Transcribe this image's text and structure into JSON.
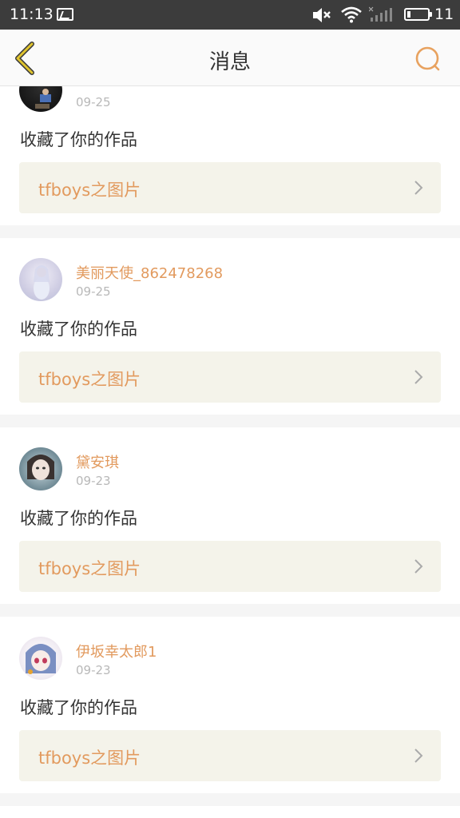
{
  "status_bar": {
    "time": "11:13",
    "battery": "11",
    "icons": [
      "screenshot-icon",
      "mute-icon",
      "wifi-icon",
      "signal-icon",
      "battery-icon"
    ]
  },
  "nav": {
    "title": "消息",
    "back_icon": "chevron-left-icon",
    "search_icon": "search-icon",
    "accent_color": "#e8a25f",
    "back_color": "#e0c42e"
  },
  "notifications": [
    {
      "username": "",
      "date": "09-25",
      "action": "收藏了你的作品",
      "link": "tfboys之图片"
    },
    {
      "username": "美丽天使_862478268",
      "date": "09-25",
      "action": "收藏了你的作品",
      "link": "tfboys之图片"
    },
    {
      "username": "黛安琪",
      "date": "09-23",
      "action": "收藏了你的作品",
      "link": "tfboys之图片"
    },
    {
      "username": "伊坂幸太郎1",
      "date": "09-23",
      "action": "收藏了你的作品",
      "link": "tfboys之图片"
    }
  ],
  "colors": {
    "username": "#e29a5e",
    "link_bg": "#f4f3ea",
    "statusbar_bg": "#3c3c3c"
  }
}
